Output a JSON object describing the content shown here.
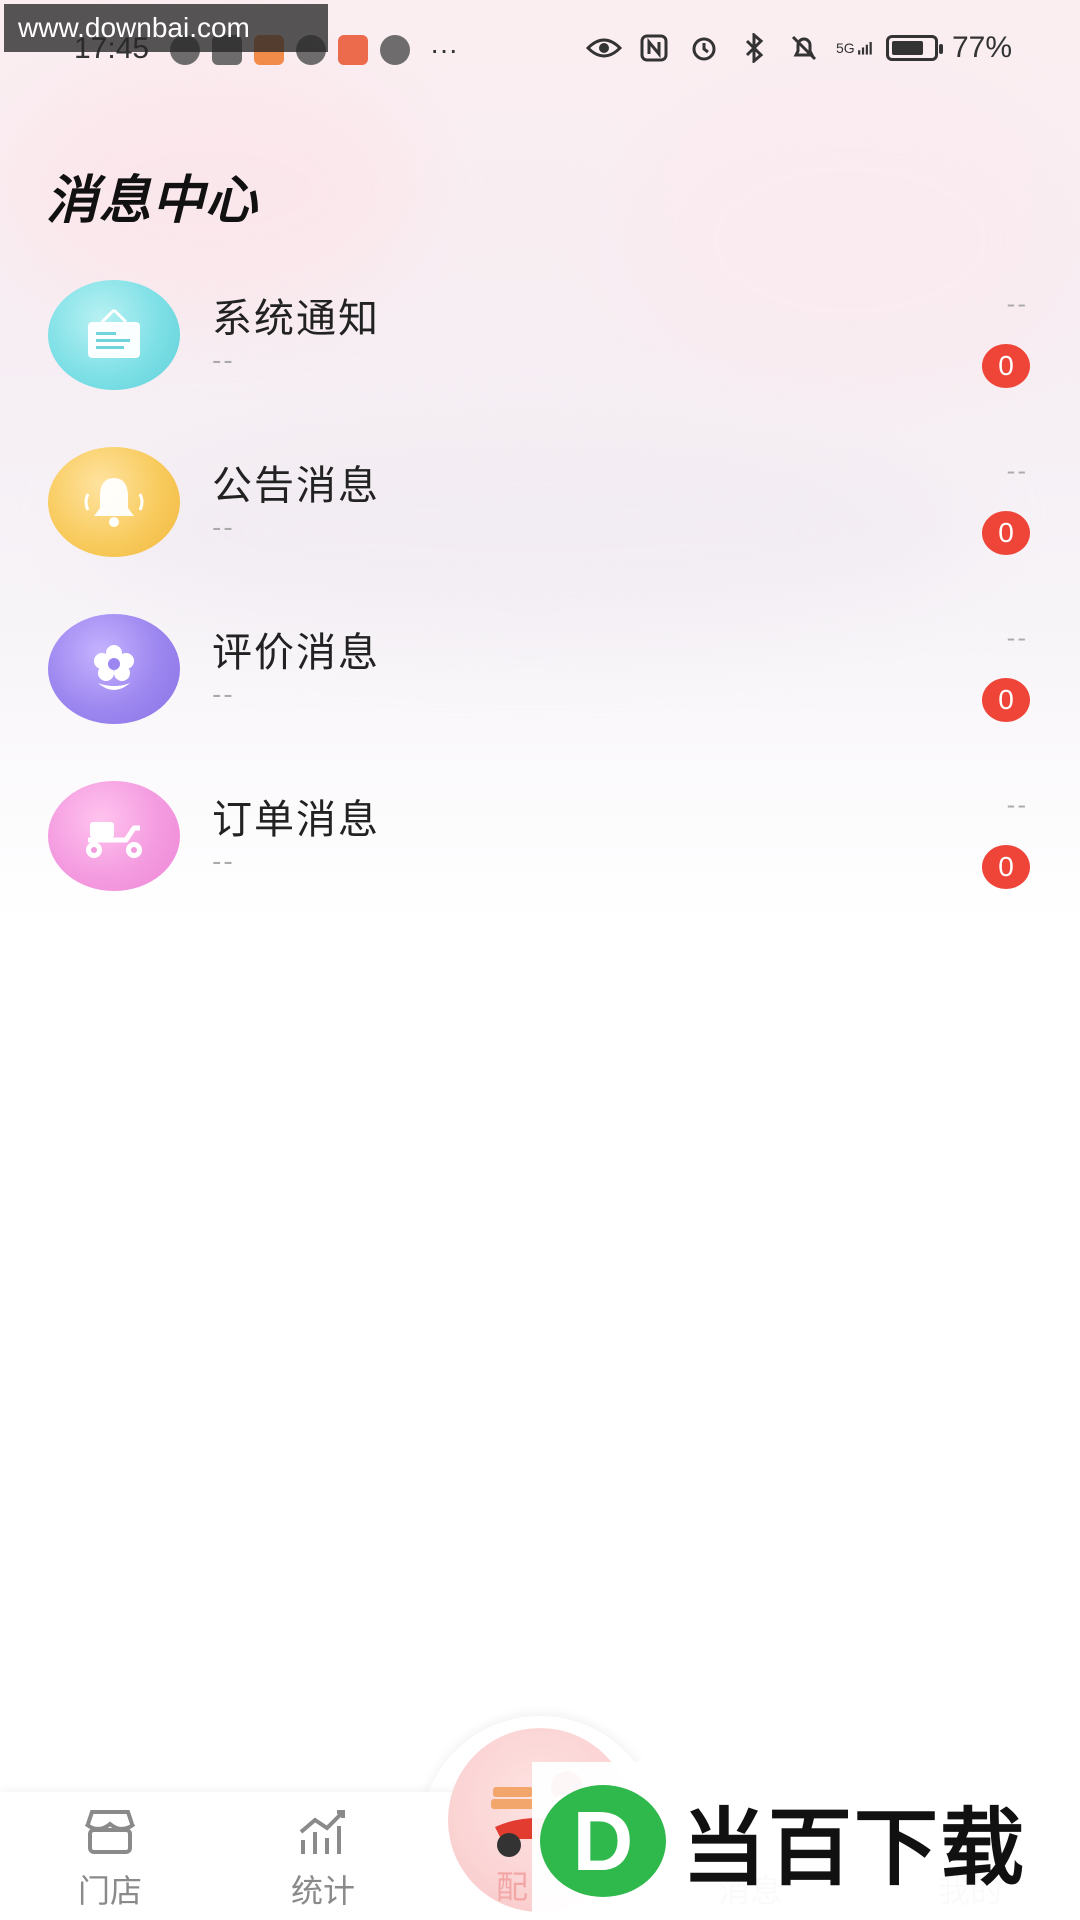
{
  "watermark": {
    "text": "www.downbai.com"
  },
  "status_bar": {
    "time": "17:45",
    "network": "5G",
    "battery_percent": "77%",
    "more": "···",
    "battery_level": 0.77
  },
  "page": {
    "title": "消息中心"
  },
  "messages": [
    {
      "title": "系统通知",
      "subtitle": "--",
      "time": "--",
      "count": "0",
      "icon": "notice-board-icon"
    },
    {
      "title": "公告消息",
      "subtitle": "--",
      "time": "--",
      "count": "0",
      "icon": "bell-icon"
    },
    {
      "title": "评价消息",
      "subtitle": "--",
      "time": "--",
      "count": "0",
      "icon": "flower-icon"
    },
    {
      "title": "订单消息",
      "subtitle": "--",
      "time": "--",
      "count": "0",
      "icon": "scooter-icon"
    }
  ],
  "bottom_nav": {
    "store": "门店",
    "stats": "统计",
    "delivery": "配",
    "messages": "消息",
    "mine": "我的"
  },
  "brand_overlay": {
    "logo_letter": "D",
    "text": "当百下载"
  },
  "colors": {
    "badge": "#ef4438",
    "system_icon": "#7ee0e6",
    "notice_icon": "#f8cb5e",
    "review_icon": "#9c86ef",
    "order_icon": "#f49be0",
    "brand_green": "#2fb84b"
  }
}
